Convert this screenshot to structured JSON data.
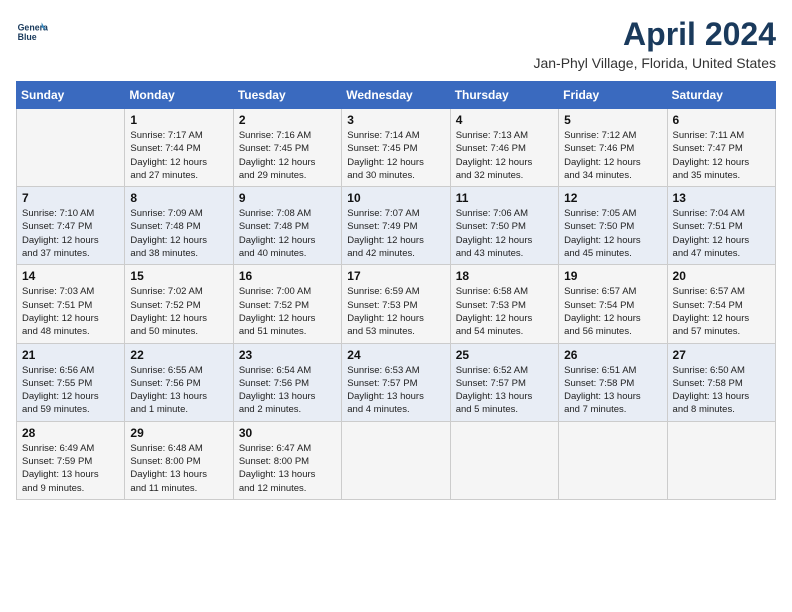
{
  "header": {
    "logo_line1": "General",
    "logo_line2": "Blue",
    "title": "April 2024",
    "subtitle": "Jan-Phyl Village, Florida, United States"
  },
  "weekdays": [
    "Sunday",
    "Monday",
    "Tuesday",
    "Wednesday",
    "Thursday",
    "Friday",
    "Saturday"
  ],
  "weeks": [
    [
      {
        "day": "",
        "details": ""
      },
      {
        "day": "1",
        "details": "Sunrise: 7:17 AM\nSunset: 7:44 PM\nDaylight: 12 hours\nand 27 minutes."
      },
      {
        "day": "2",
        "details": "Sunrise: 7:16 AM\nSunset: 7:45 PM\nDaylight: 12 hours\nand 29 minutes."
      },
      {
        "day": "3",
        "details": "Sunrise: 7:14 AM\nSunset: 7:45 PM\nDaylight: 12 hours\nand 30 minutes."
      },
      {
        "day": "4",
        "details": "Sunrise: 7:13 AM\nSunset: 7:46 PM\nDaylight: 12 hours\nand 32 minutes."
      },
      {
        "day": "5",
        "details": "Sunrise: 7:12 AM\nSunset: 7:46 PM\nDaylight: 12 hours\nand 34 minutes."
      },
      {
        "day": "6",
        "details": "Sunrise: 7:11 AM\nSunset: 7:47 PM\nDaylight: 12 hours\nand 35 minutes."
      }
    ],
    [
      {
        "day": "7",
        "details": "Sunrise: 7:10 AM\nSunset: 7:47 PM\nDaylight: 12 hours\nand 37 minutes."
      },
      {
        "day": "8",
        "details": "Sunrise: 7:09 AM\nSunset: 7:48 PM\nDaylight: 12 hours\nand 38 minutes."
      },
      {
        "day": "9",
        "details": "Sunrise: 7:08 AM\nSunset: 7:48 PM\nDaylight: 12 hours\nand 40 minutes."
      },
      {
        "day": "10",
        "details": "Sunrise: 7:07 AM\nSunset: 7:49 PM\nDaylight: 12 hours\nand 42 minutes."
      },
      {
        "day": "11",
        "details": "Sunrise: 7:06 AM\nSunset: 7:50 PM\nDaylight: 12 hours\nand 43 minutes."
      },
      {
        "day": "12",
        "details": "Sunrise: 7:05 AM\nSunset: 7:50 PM\nDaylight: 12 hours\nand 45 minutes."
      },
      {
        "day": "13",
        "details": "Sunrise: 7:04 AM\nSunset: 7:51 PM\nDaylight: 12 hours\nand 47 minutes."
      }
    ],
    [
      {
        "day": "14",
        "details": "Sunrise: 7:03 AM\nSunset: 7:51 PM\nDaylight: 12 hours\nand 48 minutes."
      },
      {
        "day": "15",
        "details": "Sunrise: 7:02 AM\nSunset: 7:52 PM\nDaylight: 12 hours\nand 50 minutes."
      },
      {
        "day": "16",
        "details": "Sunrise: 7:00 AM\nSunset: 7:52 PM\nDaylight: 12 hours\nand 51 minutes."
      },
      {
        "day": "17",
        "details": "Sunrise: 6:59 AM\nSunset: 7:53 PM\nDaylight: 12 hours\nand 53 minutes."
      },
      {
        "day": "18",
        "details": "Sunrise: 6:58 AM\nSunset: 7:53 PM\nDaylight: 12 hours\nand 54 minutes."
      },
      {
        "day": "19",
        "details": "Sunrise: 6:57 AM\nSunset: 7:54 PM\nDaylight: 12 hours\nand 56 minutes."
      },
      {
        "day": "20",
        "details": "Sunrise: 6:57 AM\nSunset: 7:54 PM\nDaylight: 12 hours\nand 57 minutes."
      }
    ],
    [
      {
        "day": "21",
        "details": "Sunrise: 6:56 AM\nSunset: 7:55 PM\nDaylight: 12 hours\nand 59 minutes."
      },
      {
        "day": "22",
        "details": "Sunrise: 6:55 AM\nSunset: 7:56 PM\nDaylight: 13 hours\nand 1 minute."
      },
      {
        "day": "23",
        "details": "Sunrise: 6:54 AM\nSunset: 7:56 PM\nDaylight: 13 hours\nand 2 minutes."
      },
      {
        "day": "24",
        "details": "Sunrise: 6:53 AM\nSunset: 7:57 PM\nDaylight: 13 hours\nand 4 minutes."
      },
      {
        "day": "25",
        "details": "Sunrise: 6:52 AM\nSunset: 7:57 PM\nDaylight: 13 hours\nand 5 minutes."
      },
      {
        "day": "26",
        "details": "Sunrise: 6:51 AM\nSunset: 7:58 PM\nDaylight: 13 hours\nand 7 minutes."
      },
      {
        "day": "27",
        "details": "Sunrise: 6:50 AM\nSunset: 7:58 PM\nDaylight: 13 hours\nand 8 minutes."
      }
    ],
    [
      {
        "day": "28",
        "details": "Sunrise: 6:49 AM\nSunset: 7:59 PM\nDaylight: 13 hours\nand 9 minutes."
      },
      {
        "day": "29",
        "details": "Sunrise: 6:48 AM\nSunset: 8:00 PM\nDaylight: 13 hours\nand 11 minutes."
      },
      {
        "day": "30",
        "details": "Sunrise: 6:47 AM\nSunset: 8:00 PM\nDaylight: 13 hours\nand 12 minutes."
      },
      {
        "day": "",
        "details": ""
      },
      {
        "day": "",
        "details": ""
      },
      {
        "day": "",
        "details": ""
      },
      {
        "day": "",
        "details": ""
      }
    ]
  ]
}
